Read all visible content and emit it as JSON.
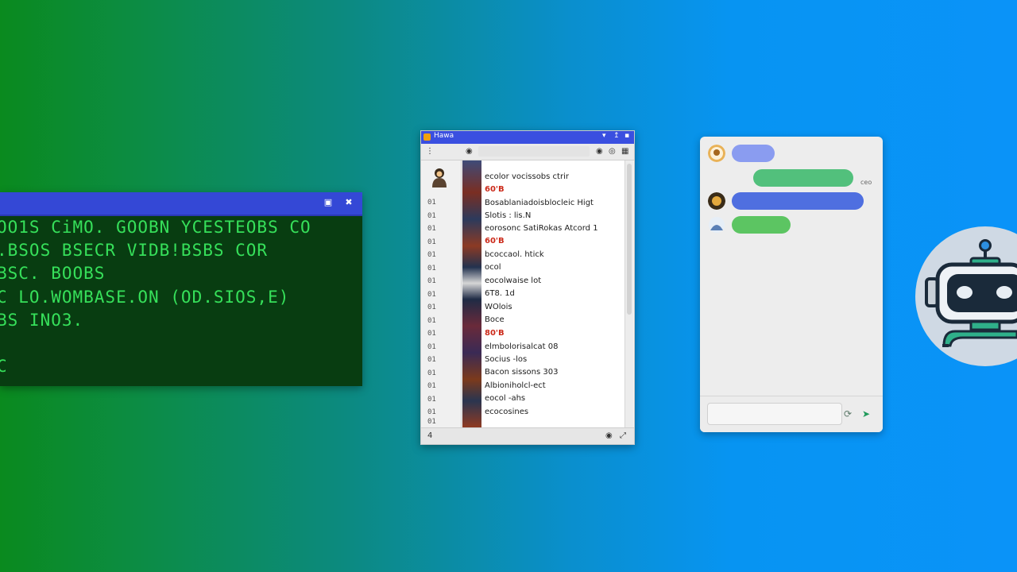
{
  "terminal": {
    "lines": [
      "OO1S CiMO. GOOBN YCESTEOBS CO",
      ".BSOS BSECR VIDB!BSBS COR",
      "BSC. BOOBS",
      "C LO.WOMBASE.ON (OD.SIOS,E)",
      "BS INO3.",
      "",
      "C"
    ]
  },
  "file_browser": {
    "title": "Hawa",
    "rows": [
      {
        "num": "",
        "text": "ecolor vocissobs ctrir",
        "red": false
      },
      {
        "num": "01",
        "text": "60'B",
        "red": true
      },
      {
        "num": "01",
        "text": "Bosablaniadoisblocleic Higt",
        "red": false
      },
      {
        "num": "01",
        "text": "Slotis : lis.N",
        "red": false
      },
      {
        "num": "01",
        "text": "eorosonc SatiRokas Atcord 1",
        "red": false
      },
      {
        "num": "01",
        "text": "60'B",
        "red": true
      },
      {
        "num": "01",
        "text": "bcoccaol. htick",
        "red": false
      },
      {
        "num": "01",
        "text": "ocol",
        "red": false
      },
      {
        "num": "01",
        "text": "eocolwaise lot",
        "red": false
      },
      {
        "num": "01",
        "text": "6T8.  1d",
        "red": false
      },
      {
        "num": "01",
        "text": "WOlois",
        "red": false
      },
      {
        "num": "01",
        "text": "Boce",
        "red": false
      },
      {
        "num": "01",
        "text": "80'B",
        "red": true
      },
      {
        "num": "01",
        "text": "elmbolorisalcat 08",
        "red": false
      },
      {
        "num": "01",
        "text": "Socius -los",
        "red": false
      },
      {
        "num": "01",
        "text": "Bacon sissons 303",
        "red": false
      },
      {
        "num": "01",
        "text": "Albioniholcl-ect",
        "red": false
      },
      {
        "num": "01",
        "text": "eocol  -ahs",
        "red": false
      },
      {
        "num": "01",
        "text": "ecocosines",
        "red": false
      }
    ],
    "status_left": "4"
  },
  "chat": {
    "meta": "ceo",
    "colors": {
      "bubble_purple": "#8a9cf0",
      "bubble_green": "#52c07c",
      "bubble_blue": "#4f6fe0",
      "bubble_green2": "#5cc562"
    }
  },
  "colors": {
    "terminal_text": "#36e05a",
    "terminal_bg": "#083d11",
    "titlebar": "#3448d6",
    "robot_teal": "#2fb08a"
  }
}
